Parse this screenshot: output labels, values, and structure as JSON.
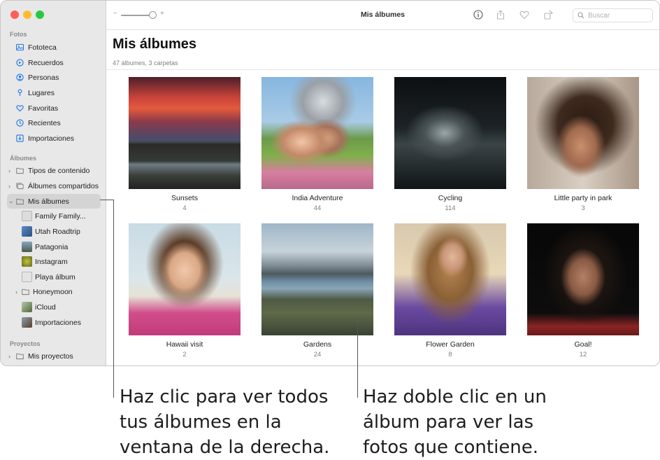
{
  "window": {
    "title": "Mis álbumes"
  },
  "search": {
    "placeholder": "Buscar"
  },
  "sidebar": {
    "sections": {
      "fotos": "Fotos",
      "albumes": "Álbumes",
      "proyectos": "Proyectos"
    },
    "fotos_items": [
      {
        "label": "Fototeca",
        "icon": "photo-library-icon"
      },
      {
        "label": "Recuerdos",
        "icon": "memories-icon"
      },
      {
        "label": "Personas",
        "icon": "people-icon"
      },
      {
        "label": "Lugares",
        "icon": "places-icon"
      },
      {
        "label": "Favoritas",
        "icon": "heart-icon"
      },
      {
        "label": "Recientes",
        "icon": "clock-icon"
      },
      {
        "label": "Importaciones",
        "icon": "import-icon"
      }
    ],
    "album_items": [
      {
        "label": "Tipos de contenido"
      },
      {
        "label": "Álbumes compartidos"
      },
      {
        "label": "Mis álbumes"
      },
      {
        "label": "Family Family..."
      },
      {
        "label": "Utah Roadtrip"
      },
      {
        "label": "Patagonia"
      },
      {
        "label": "Instagram"
      },
      {
        "label": "Playa álbum"
      },
      {
        "label": "Honeymoon"
      },
      {
        "label": "iCloud"
      },
      {
        "label": "Importaciones"
      }
    ],
    "project_items": [
      {
        "label": "Mis proyectos"
      }
    ]
  },
  "main": {
    "title": "Mis álbumes",
    "subtitle": "47 álbumes, 3 carpetas",
    "albums": [
      {
        "name": "Sunsets",
        "count": "4"
      },
      {
        "name": "India Adventure",
        "count": "44"
      },
      {
        "name": "Cycling",
        "count": "114"
      },
      {
        "name": "Little party in park",
        "count": "3"
      },
      {
        "name": "Hawaii visit",
        "count": "2"
      },
      {
        "name": "Gardens",
        "count": "24"
      },
      {
        "name": "Flower Garden",
        "count": "8"
      },
      {
        "name": "Goal!",
        "count": "12"
      }
    ]
  },
  "callouts": {
    "left": [
      "Haz clic para ver todos",
      "tus álbumes en la",
      "ventana de la derecha."
    ],
    "right": [
      "Haz doble clic en un",
      "álbum para ver las",
      "fotos que contiene."
    ]
  },
  "colors": {
    "accent": "#1a73e8",
    "sidebar_bg": "#e8e8e8",
    "selected_row": "#d4d4d4"
  }
}
